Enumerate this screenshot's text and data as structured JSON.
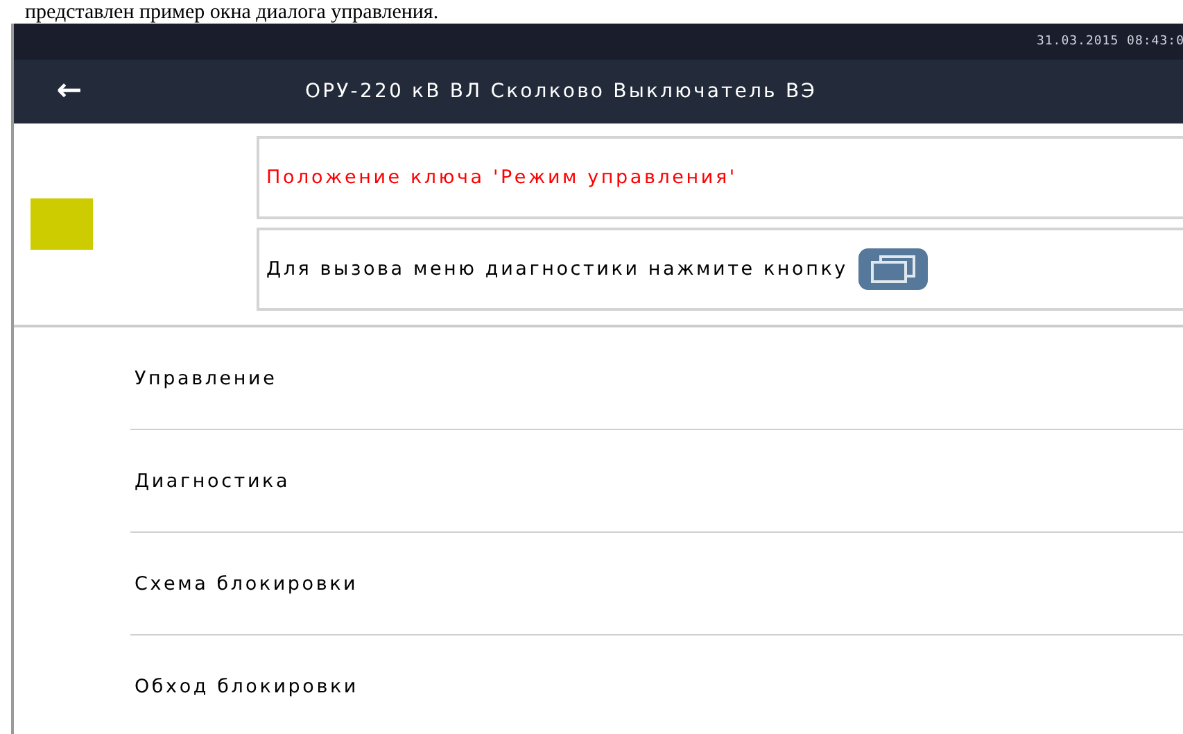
{
  "caption": "представлен пример окна диалога управления.",
  "status_bar": {
    "datetime": "31.03.2015 08:43:0"
  },
  "title_bar": {
    "back_icon": "←",
    "title": "ОРУ-220 кВ ВЛ Сколково Выключатель ВЭ"
  },
  "indicator": {
    "color": "#cccc00"
  },
  "messages": [
    {
      "kind": "alert",
      "text": "Положение ключа 'Режим управления'"
    },
    {
      "kind": "hint",
      "text": "Для вызова меню диагностики нажмите кнопку"
    }
  ],
  "menu": [
    {
      "label": "Управление"
    },
    {
      "label": "Диагностика"
    },
    {
      "label": "Схема блокировки"
    },
    {
      "label": "Обход блокировки"
    }
  ]
}
